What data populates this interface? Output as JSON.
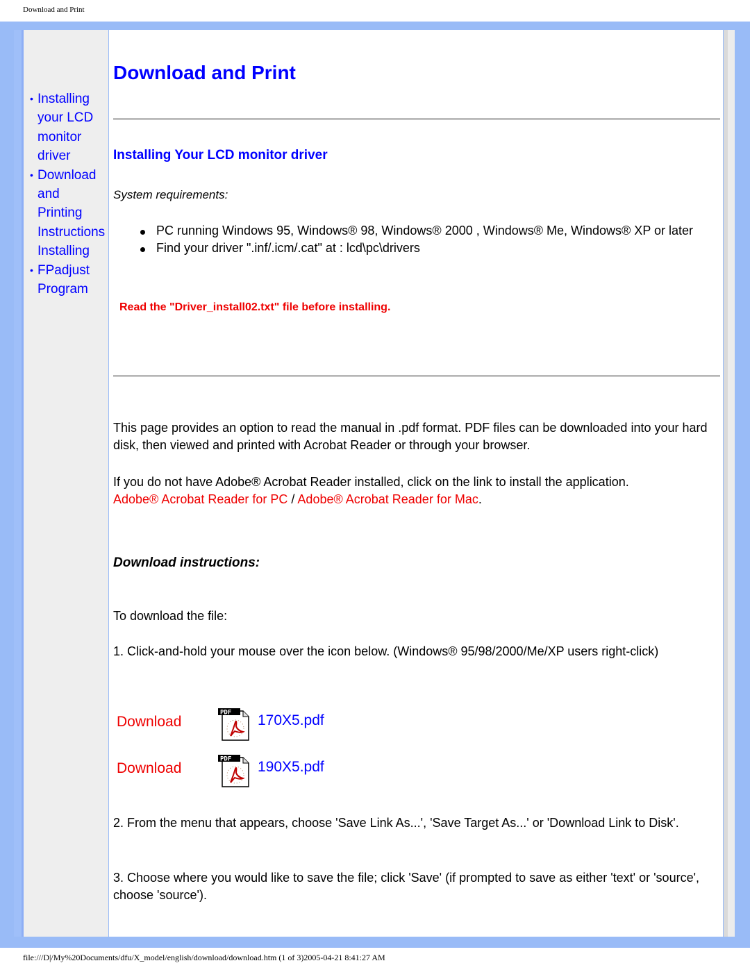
{
  "print_header": "Download and Print",
  "sidebar": {
    "items": [
      {
        "label_lines": [
          "Installing",
          "your LCD",
          "monitor",
          "driver"
        ],
        "bullet": true
      },
      {
        "label_lines": [
          "Download",
          "and",
          "Printing",
          "Instructions",
          "Installing"
        ],
        "bullet": true
      },
      {
        "label_lines": [
          "FPadjust",
          "Program"
        ],
        "bullet": true
      }
    ]
  },
  "main": {
    "title": "Download and Print",
    "section_title": "Installing Your LCD monitor driver",
    "system_requirements_label": "System requirements:",
    "requirements": [
      "PC running Windows 95, Windows® 98, Windows® 2000 , Windows® Me, Windows® XP or later",
      "Find your driver \".inf/.icm/.cat\" at : lcd\\pc\\drivers"
    ],
    "warning": "Read the \"Driver_install02.txt\" file before installing.",
    "intro_paragraph": "This page provides an option to read the manual in .pdf format. PDF files can be downloaded into your hard disk, then viewed and printed with Acrobat Reader or through your browser.",
    "acrobat_paragraph": "If you do not have Adobe® Acrobat Reader installed, click on the link to install the application.",
    "acrobat_pc_link": "Adobe® Acrobat Reader for PC",
    "acrobat_separator": " / ",
    "acrobat_mac_link": "Adobe® Acrobat Reader for Mac",
    "acrobat_trailing": ".",
    "download_heading": "Download instructions:",
    "to_download": "To download the file:",
    "step1": "1. Click-and-hold your mouse over the icon below. (Windows® 95/98/2000/Me/XP users right-click)",
    "downloads": [
      {
        "label": "Download",
        "icon": "pdf-file-icon",
        "file": "170X5.pdf"
      },
      {
        "label": "Download",
        "icon": "pdf-file-icon",
        "file": "190X5.pdf"
      }
    ],
    "step2": "2. From the menu that appears, choose 'Save Link As...', 'Save Target As...' or 'Download Link to Disk'.",
    "step3": "3. Choose where you would like to save the file; click 'Save' (if prompted to save as either 'text' or 'source', choose 'source')."
  },
  "footer": "file:///D|/My%20Documents/dfu/X_model/english/download/download.htm (1 of 3)2005-04-21 8:41:27 AM",
  "colors": {
    "frame_blue": "#99bbf7",
    "link_blue": "#0000ff",
    "alert_red": "#ee0000",
    "sidebar_grey": "#eeeeee"
  }
}
